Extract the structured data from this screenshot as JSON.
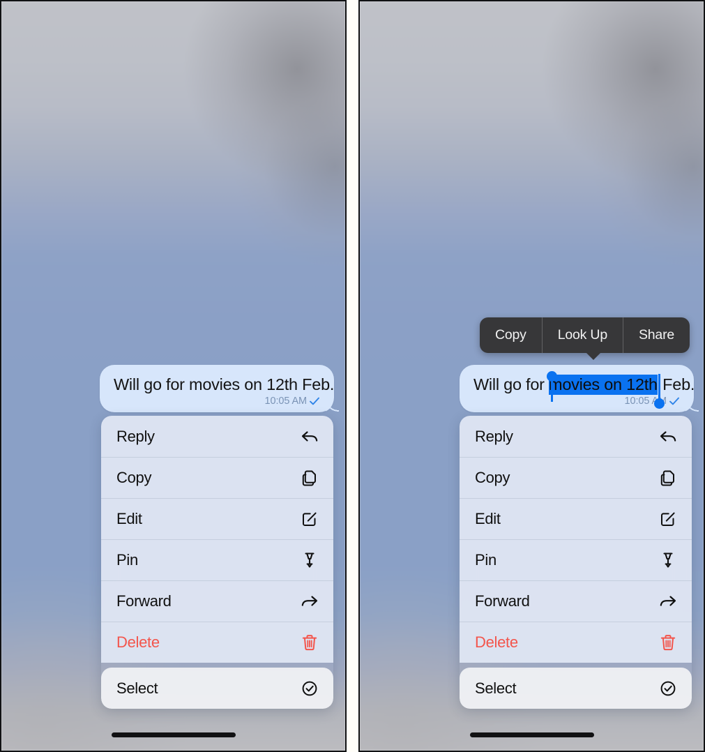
{
  "screen": {
    "message": {
      "text_full": "Will go for movies on 12th Feb.",
      "text_before_selection": "Will go for ",
      "text_selected": "movies on 12th",
      "text_after_selection": " Feb.",
      "timestamp": "10:05 AM",
      "delivery_icon": "checkmark-icon",
      "bubble_color": "#d7e6fb",
      "timestamp_color": "#7a93b5",
      "selection_color": "#0a72f0"
    },
    "edit_popup": {
      "items": [
        {
          "label": "Copy",
          "name": "copy"
        },
        {
          "label": "Look Up",
          "name": "look-up"
        },
        {
          "label": "Share",
          "name": "share"
        }
      ],
      "background_color": "#373739"
    },
    "context_menu": {
      "primary_items": [
        {
          "label": "Reply",
          "icon": "reply-arrow-icon",
          "danger": false
        },
        {
          "label": "Copy",
          "icon": "copy-pages-icon",
          "danger": false
        },
        {
          "label": "Edit",
          "icon": "pencil-square-icon",
          "danger": false
        },
        {
          "label": "Pin",
          "icon": "pushpin-icon",
          "danger": false
        },
        {
          "label": "Forward",
          "icon": "forward-arrow-icon",
          "danger": false
        },
        {
          "label": "Delete",
          "icon": "trash-icon",
          "danger": true
        }
      ],
      "secondary_items": [
        {
          "label": "Select",
          "icon": "check-circle-icon",
          "danger": false
        }
      ],
      "danger_color": "#f3554c"
    },
    "home_indicator": "home-indicator-bar"
  },
  "panels": [
    {
      "id": "left",
      "name": "screenshot-panel-left",
      "has_edit_popup": false,
      "has_selection": false
    },
    {
      "id": "right",
      "name": "screenshot-panel-right",
      "has_edit_popup": true,
      "has_selection": true
    }
  ]
}
